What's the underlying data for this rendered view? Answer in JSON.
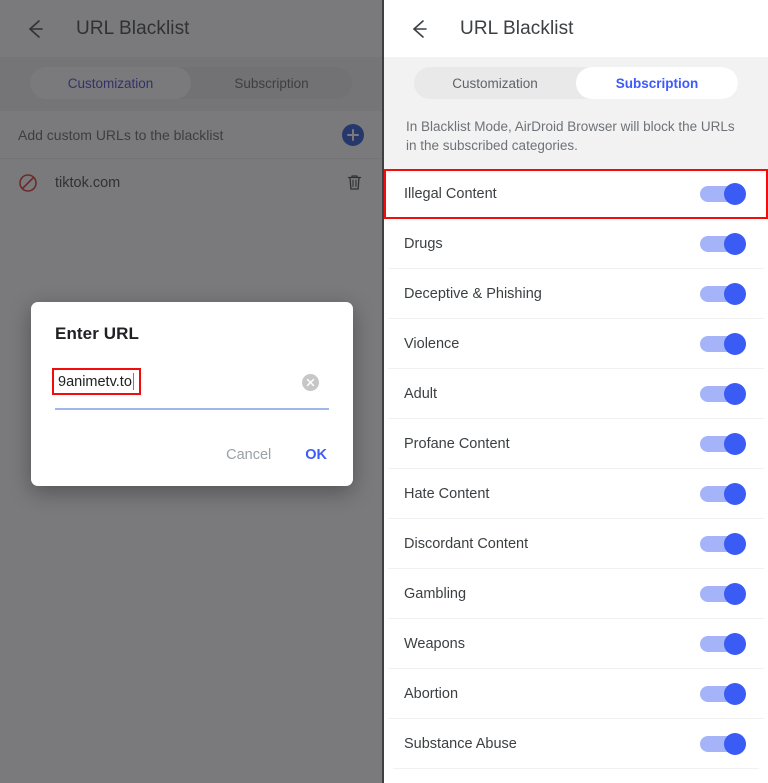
{
  "left_panel": {
    "appbar": {
      "back_icon": "back-arrow-icon",
      "title": "URL Blacklist"
    },
    "tabs": [
      {
        "label": "Customization",
        "active": true
      },
      {
        "label": "Subscription",
        "active": false
      }
    ],
    "add_row": {
      "label": "Add custom URLs to the blacklist",
      "button_icon": "plus-circle-icon"
    },
    "url_items": [
      {
        "icon": "block-circle-icon",
        "url": "tiktok.com",
        "delete_icon": "trash-icon"
      }
    ]
  },
  "dialog": {
    "title": "Enter URL",
    "input_value": "9animetv.to",
    "clear_icon": "clear-circle-icon",
    "cancel_label": "Cancel",
    "ok_label": "OK"
  },
  "right_panel": {
    "appbar": {
      "back_icon": "back-arrow-icon",
      "title": "URL Blacklist"
    },
    "tabs": [
      {
        "label": "Customization",
        "active": false
      },
      {
        "label": "Subscription",
        "active": true
      }
    ],
    "description": "In Blacklist Mode, AirDroid Browser will block the URLs in the subscribed categories.",
    "categories": [
      {
        "label": "Illegal Content",
        "enabled": true
      },
      {
        "label": "Drugs",
        "enabled": true
      },
      {
        "label": "Deceptive & Phishing",
        "enabled": true
      },
      {
        "label": "Violence",
        "enabled": true
      },
      {
        "label": "Adult",
        "enabled": true
      },
      {
        "label": "Profane Content",
        "enabled": true
      },
      {
        "label": "Hate Content",
        "enabled": true
      },
      {
        "label": "Discordant Content",
        "enabled": true
      },
      {
        "label": "Gambling",
        "enabled": true
      },
      {
        "label": "Weapons",
        "enabled": true
      },
      {
        "label": "Abortion",
        "enabled": true
      },
      {
        "label": "Substance Abuse",
        "enabled": true
      }
    ]
  },
  "colors": {
    "accent_blue": "#3d5afe",
    "toggle_track": "#a5b4f8",
    "toggle_thumb": "#3b5bf5",
    "annotation_red": "#f20c0c",
    "scrim": "#606062",
    "block_red": "#d93025"
  }
}
